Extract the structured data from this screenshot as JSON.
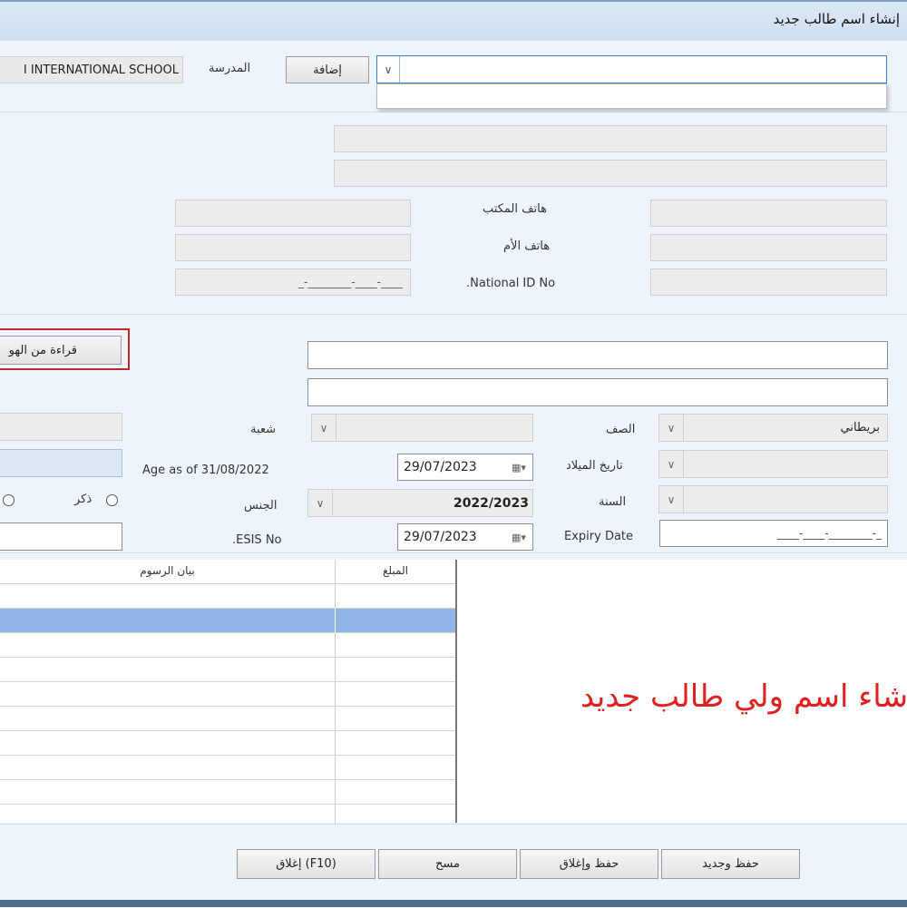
{
  "window": {
    "title": "إنشاء اسم طالب جديد"
  },
  "school": {
    "label": "المدرسة",
    "value": "I INTERNATIONAL SCHOOL",
    "add_button": "إضافة",
    "dropdown_value": ""
  },
  "contact": {
    "office_phone_label": "هاتف المكتب",
    "mother_phone_label": "هاتف الأم",
    "national_id_label": ".National ID No",
    "national_id_mask": "_-________-____-____"
  },
  "read_button": "قراءة من الهو",
  "student": {
    "grade_label": "الصف",
    "grade_value": "بريطاني",
    "section_label": "شعبة",
    "birthdate_label": "تاريخ الميلاد",
    "birthdate_value": "29/07/2023",
    "age_label": "Age as of 31/08/2022",
    "year_label": "السنة",
    "year_value": "2022/2023",
    "gender_label": "الجنس",
    "male_label": "ذكر",
    "expiry_label": "Expiry Date",
    "expiry_value": "29/07/2023",
    "expiry_mask": "____-____-________-_",
    "esis_label": ".ESIS No"
  },
  "fees_table": {
    "columns": [
      "المبلغ",
      "بيان الرسوم"
    ]
  },
  "note": "شاء اسم ولي طالب جديد",
  "footer": {
    "save_new": "حفظ وجديد",
    "save_close": "حفظ وإغلاق",
    "clear": "مسح",
    "close": "إغلاق (F10)"
  },
  "colors": {
    "note": "#e02020",
    "selected_row": "#8fb4e8",
    "highlight_border": "#c0282a"
  }
}
